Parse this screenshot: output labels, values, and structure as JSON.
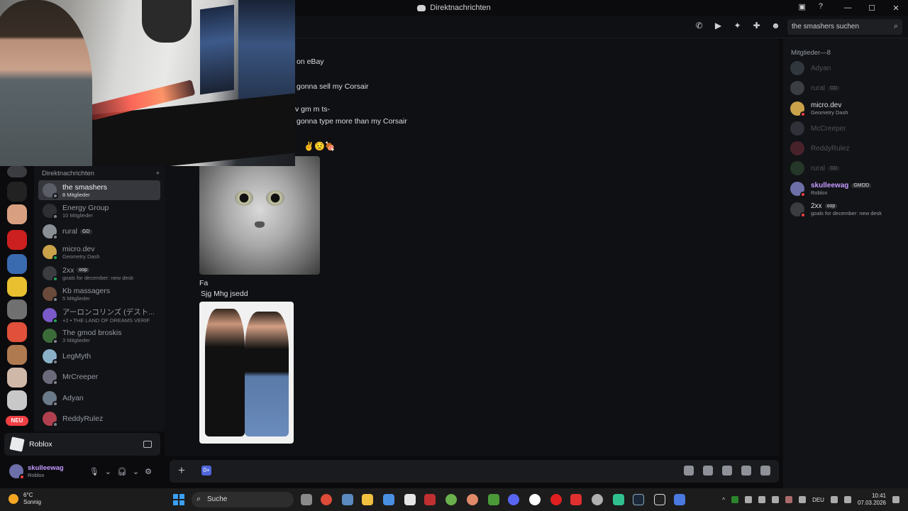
{
  "window": {
    "title": "Direktnachrichten"
  },
  "header": {
    "search_placeholder": "the smashers suchen"
  },
  "dm_list": {
    "section_label": "Direktnachrichten",
    "add_symbol": "+",
    "items": [
      {
        "name": "the smashers",
        "sub": "8 Mitglieder",
        "active": true,
        "color": "#5b5e66"
      },
      {
        "name": "Energy Group",
        "sub": "10 Mitglieder",
        "color": "#2e2f33"
      },
      {
        "name": "rural",
        "tag": "GD",
        "color": "#8a8f95"
      },
      {
        "name": "micro.dev",
        "sub": "Geometry Dash",
        "color": "#c9a24a"
      },
      {
        "name": "2xx",
        "tag": "oop",
        "sub": "goals for december: new desk",
        "color": "#3a3c40"
      },
      {
        "name": "Kb massagers",
        "sub": "5 Mitglieder",
        "color": "#6a4a3a"
      },
      {
        "name": "アーロンコリンズ (デスト...",
        "sub": "+2 • THE LAND OF DREAMS VERIF",
        "color": "#7a5ac8"
      },
      {
        "name": "The gmod broskis",
        "sub": "3 Mitglieder",
        "color": "#3c6b3a"
      },
      {
        "name": "LegMyth",
        "color": "#8ab0c8"
      },
      {
        "name": "MrCreeper",
        "color": "#6a6a7a"
      },
      {
        "name": "Adyan",
        "color": "#6b7a88"
      },
      {
        "name": "ReddyRulez",
        "color": "#b04050"
      }
    ]
  },
  "activity": {
    "game": "Roblox"
  },
  "user_panel": {
    "name": "skulleewag",
    "status": "Roblox"
  },
  "rail": {
    "new_badge": "NEU"
  },
  "chat": {
    "messages": [
      "on eBay",
      "gonna sell my Corsair",
      "v gm m ts-",
      "gonna type more than my Corsair",
      "✌😟🍖"
    ],
    "caption_1": "Fa",
    "caption_2": "Sjg Mhg jsedd"
  },
  "composer": {
    "plus": "+",
    "chip": "0+"
  },
  "members": {
    "header": "Mitglieder—8",
    "list": [
      {
        "name": "Adyan",
        "offline": true,
        "color": "#6b7a88"
      },
      {
        "name": "rural",
        "tag": "GD",
        "offline": true,
        "color": "#8a8f95"
      },
      {
        "name": "micro.dev",
        "sub": "Geometry Dash",
        "color": "#c9a24a"
      },
      {
        "name": "McCreeper",
        "offline": true,
        "color": "#6a6a7a"
      },
      {
        "name": "ReddyRulez",
        "offline": true,
        "color": "#b04050"
      },
      {
        "name": "rural",
        "tag": "GD",
        "offline": true,
        "color": "#4a7a4a"
      },
      {
        "name": "skulleewag",
        "tag": "GMOD",
        "sub": "Roblox",
        "color": "#6d6fa8"
      },
      {
        "name": "2xx",
        "tag": "oop",
        "sub": "goals for december: new desk",
        "color": "#3a3c40"
      }
    ]
  },
  "taskbar": {
    "temperature": "6°C",
    "weather": "Sonnig",
    "search": "Suche",
    "language": "DEU",
    "time": "10:41",
    "date": "07.03.2026"
  }
}
